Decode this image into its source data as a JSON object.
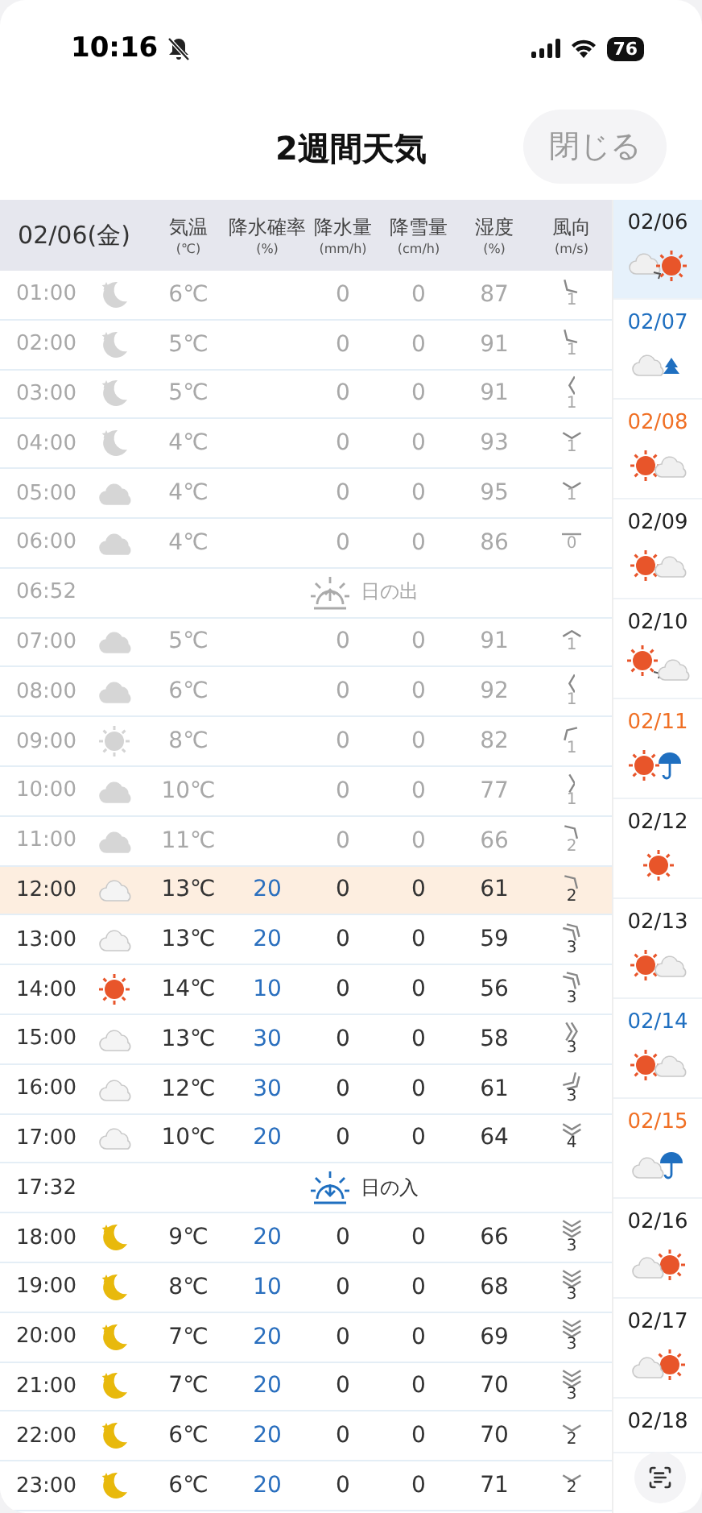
{
  "status_bar": {
    "time": "10:16",
    "silent": true,
    "battery": "76"
  },
  "nav": {
    "title": "2週間天気",
    "close_button": "閉じる"
  },
  "table": {
    "date": "02/06(金)",
    "columns": [
      {
        "label": "気温",
        "unit": "(℃)"
      },
      {
        "label": "降水確率",
        "unit": "(%)"
      },
      {
        "label": "降水量",
        "unit": "(mm/h)"
      },
      {
        "label": "降雪量",
        "unit": "(cm/h)"
      },
      {
        "label": "湿度",
        "unit": "(%)"
      },
      {
        "label": "風向",
        "unit": "(m/s)"
      }
    ],
    "rows": [
      {
        "kind": "moon",
        "time": "01:00",
        "temp": "6℃",
        "rain": "0",
        "snow": "0",
        "humidity": "87",
        "wind_speed": "1",
        "past": true,
        "current": false
      },
      {
        "kind": "moon",
        "time": "02:00",
        "temp": "5℃",
        "rain": "0",
        "snow": "0",
        "humidity": "91",
        "wind_speed": "1",
        "past": true,
        "current": false
      },
      {
        "kind": "moon",
        "time": "03:00",
        "temp": "5℃",
        "rain": "0",
        "snow": "0",
        "humidity": "91",
        "wind_speed": "1",
        "past": true,
        "current": false
      },
      {
        "kind": "moon",
        "time": "04:00",
        "temp": "4℃",
        "rain": "0",
        "snow": "0",
        "humidity": "93",
        "wind_speed": "1",
        "past": true,
        "current": false
      },
      {
        "kind": "cloud",
        "time": "05:00",
        "temp": "4℃",
        "rain": "0",
        "snow": "0",
        "humidity": "95",
        "wind_speed": "1",
        "past": true,
        "current": false
      },
      {
        "kind": "cloud",
        "time": "06:00",
        "temp": "4℃",
        "rain": "0",
        "snow": "0",
        "humidity": "86",
        "wind_speed": "0",
        "past": true,
        "current": false
      },
      {
        "kind": "sunrise",
        "time": "06:52",
        "label": "日の出",
        "past": true
      },
      {
        "kind": "cloud",
        "time": "07:00",
        "temp": "5℃",
        "rain": "0",
        "snow": "0",
        "humidity": "91",
        "wind_speed": "1",
        "past": true,
        "current": false
      },
      {
        "kind": "cloud",
        "time": "08:00",
        "temp": "6℃",
        "rain": "0",
        "snow": "0",
        "humidity": "92",
        "wind_speed": "1",
        "past": true,
        "current": false
      },
      {
        "kind": "sun",
        "time": "09:00",
        "temp": "8℃",
        "rain": "0",
        "snow": "0",
        "humidity": "82",
        "wind_speed": "1",
        "past": true,
        "current": false
      },
      {
        "kind": "cloud",
        "time": "10:00",
        "temp": "10℃",
        "rain": "0",
        "snow": "0",
        "humidity": "77",
        "wind_speed": "1",
        "past": true,
        "current": false
      },
      {
        "kind": "cloud",
        "time": "11:00",
        "temp": "11℃",
        "rain": "0",
        "snow": "0",
        "humidity": "66",
        "wind_speed": "2",
        "past": true,
        "current": false
      },
      {
        "kind": "cloud",
        "time": "12:00",
        "temp": "13℃",
        "pop": "20",
        "rain": "0",
        "snow": "0",
        "humidity": "61",
        "wind_speed": "2",
        "past": false,
        "current": true
      },
      {
        "kind": "cloud",
        "time": "13:00",
        "temp": "13℃",
        "pop": "20",
        "rain": "0",
        "snow": "0",
        "humidity": "59",
        "wind_speed": "3",
        "past": false,
        "current": false
      },
      {
        "kind": "sun",
        "time": "14:00",
        "temp": "14℃",
        "pop": "10",
        "rain": "0",
        "snow": "0",
        "humidity": "56",
        "wind_speed": "3",
        "past": false,
        "current": false
      },
      {
        "kind": "cloud",
        "time": "15:00",
        "temp": "13℃",
        "pop": "30",
        "rain": "0",
        "snow": "0",
        "humidity": "58",
        "wind_speed": "3",
        "past": false,
        "current": false
      },
      {
        "kind": "cloud",
        "time": "16:00",
        "temp": "12℃",
        "pop": "30",
        "rain": "0",
        "snow": "0",
        "humidity": "61",
        "wind_speed": "3",
        "past": false,
        "current": false
      },
      {
        "kind": "cloud",
        "time": "17:00",
        "temp": "10℃",
        "pop": "20",
        "rain": "0",
        "snow": "0",
        "humidity": "64",
        "wind_speed": "4",
        "past": false,
        "current": false
      },
      {
        "kind": "sunset",
        "time": "17:32",
        "label": "日の入",
        "past": false
      },
      {
        "kind": "moon",
        "time": "18:00",
        "temp": "9℃",
        "pop": "20",
        "rain": "0",
        "snow": "0",
        "humidity": "66",
        "wind_speed": "3",
        "past": false,
        "current": false
      },
      {
        "kind": "moon",
        "time": "19:00",
        "temp": "8℃",
        "pop": "10",
        "rain": "0",
        "snow": "0",
        "humidity": "68",
        "wind_speed": "3",
        "past": false,
        "current": false
      },
      {
        "kind": "moon",
        "time": "20:00",
        "temp": "7℃",
        "pop": "20",
        "rain": "0",
        "snow": "0",
        "humidity": "69",
        "wind_speed": "3",
        "past": false,
        "current": false
      },
      {
        "kind": "moon",
        "time": "21:00",
        "temp": "7℃",
        "pop": "20",
        "rain": "0",
        "snow": "0",
        "humidity": "70",
        "wind_speed": "3",
        "past": false,
        "current": false
      },
      {
        "kind": "moon",
        "time": "22:00",
        "temp": "6℃",
        "pop": "20",
        "rain": "0",
        "snow": "0",
        "humidity": "70",
        "wind_speed": "2",
        "past": false,
        "current": false
      },
      {
        "kind": "moon",
        "time": "23:00",
        "temp": "6℃",
        "pop": "20",
        "rain": "0",
        "snow": "0",
        "humidity": "71",
        "wind_speed": "2",
        "past": false,
        "current": false
      }
    ]
  },
  "days": [
    {
      "kind": "cloud-then-sun",
      "date": "02/06",
      "color": "#222222",
      "selected": true
    },
    {
      "kind": "cloud-snow",
      "date": "02/07",
      "color": "#1f6fc0",
      "selected": false
    },
    {
      "kind": "sun-cloud",
      "date": "02/08",
      "color": "#f07025",
      "selected": false
    },
    {
      "kind": "sun-cloud",
      "date": "02/09",
      "color": "#222222",
      "selected": false
    },
    {
      "kind": "sun-then-cloud",
      "date": "02/10",
      "color": "#222222",
      "selected": false
    },
    {
      "kind": "sun-umbrella",
      "date": "02/11",
      "color": "#f07025",
      "selected": false
    },
    {
      "kind": "sun",
      "date": "02/12",
      "color": "#222222",
      "selected": false
    },
    {
      "kind": "sun-cloud",
      "date": "02/13",
      "color": "#222222",
      "selected": false
    },
    {
      "kind": "sun-cloud",
      "date": "02/14",
      "color": "#1f6fc0",
      "selected": false
    },
    {
      "kind": "cloud-umbrella",
      "date": "02/15",
      "color": "#f07025",
      "selected": false
    },
    {
      "kind": "cloud-sun",
      "date": "02/16",
      "color": "#222222",
      "selected": false
    },
    {
      "kind": "cloud-sun",
      "date": "02/17",
      "color": "#222222",
      "selected": false
    },
    {
      "kind": "cut",
      "date": "02/18",
      "color": "#222222",
      "selected": false
    }
  ]
}
